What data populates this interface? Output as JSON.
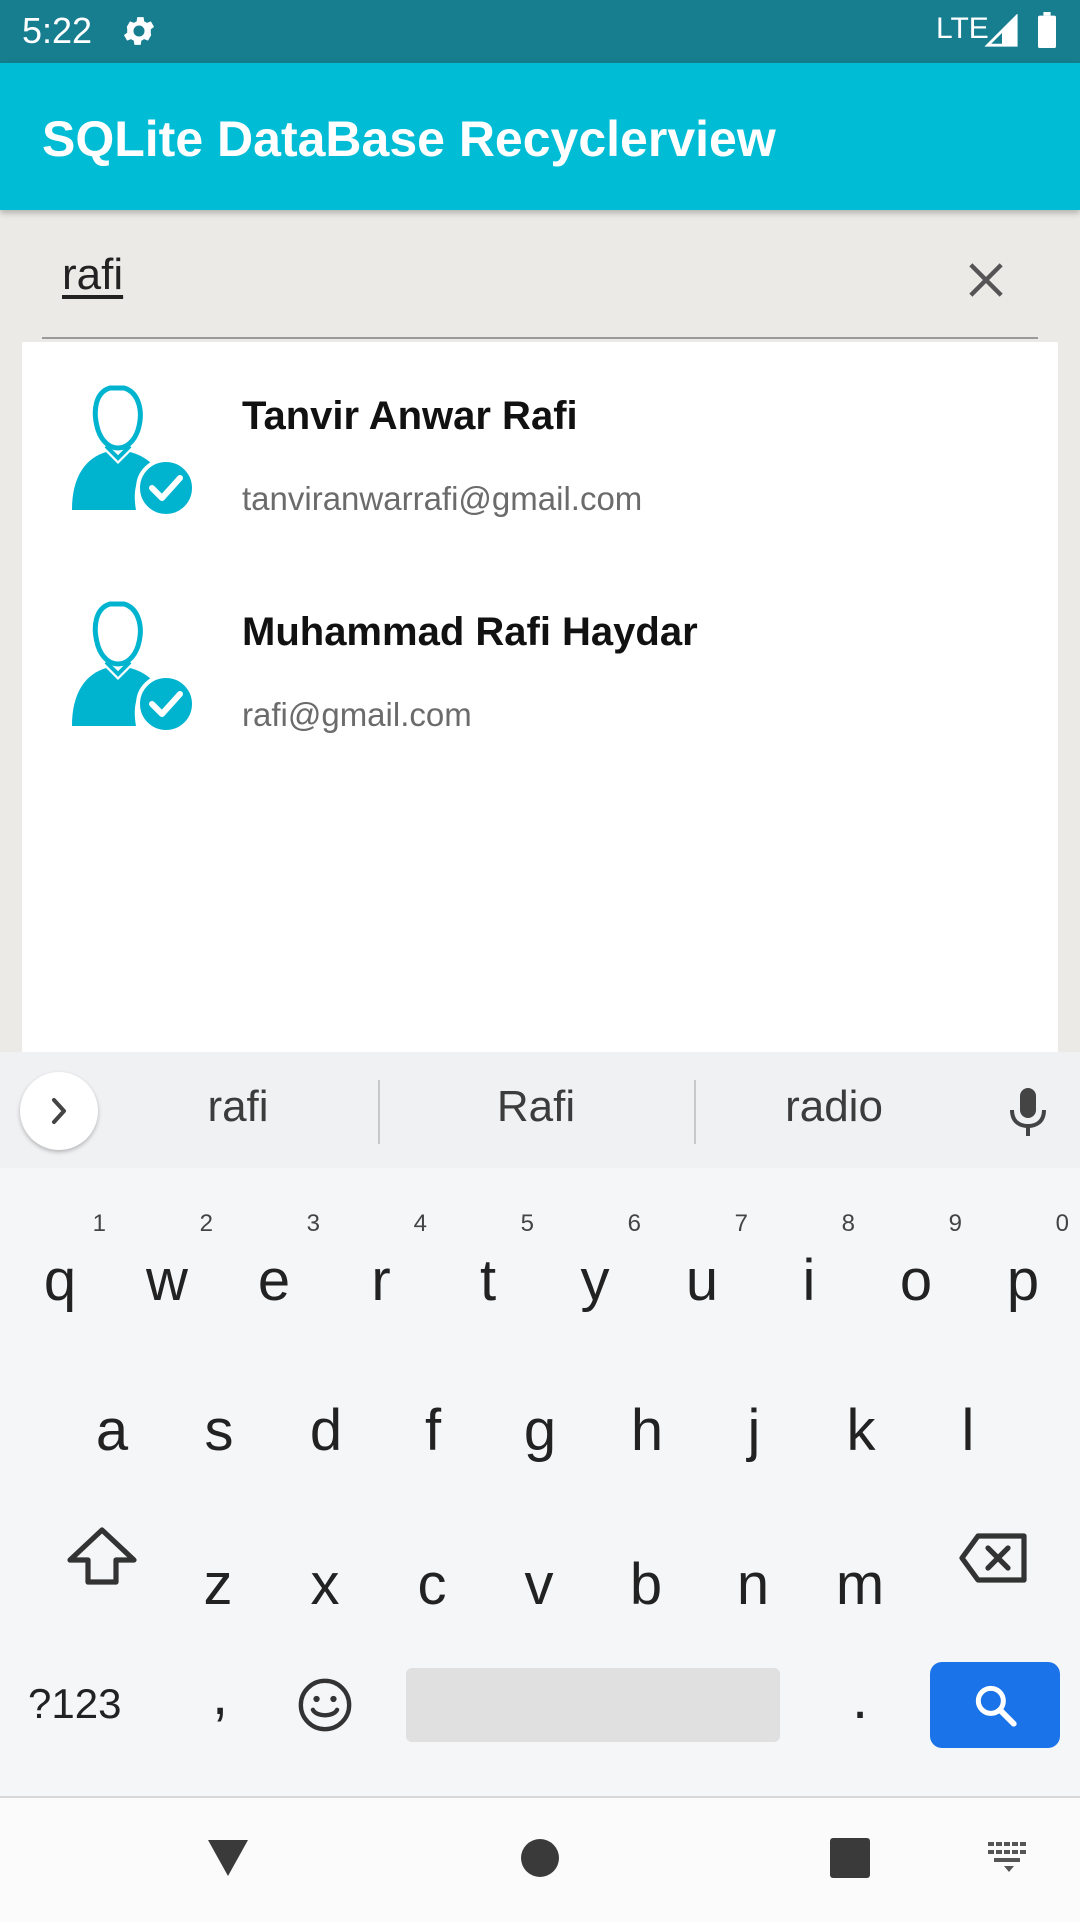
{
  "status_bar": {
    "time": "5:22",
    "network": "LTE",
    "icons": [
      "gear-icon",
      "signal-icon",
      "battery-icon"
    ]
  },
  "app_bar": {
    "title": "SQLite DataBase Recyclerview",
    "color": "#00bcd4"
  },
  "search": {
    "value": "rafi",
    "clear_icon": "close-icon"
  },
  "contacts": [
    {
      "name": "Tanvir Anwar Rafi",
      "email": "tanviranwarrafi@gmail.com",
      "icon": "verified-user-icon"
    },
    {
      "name": "Muhammad Rafi Haydar",
      "email": "rafi@gmail.com",
      "icon": "verified-user-icon"
    }
  ],
  "keyboard": {
    "suggestions": [
      "rafi",
      "Rafi",
      "radio"
    ],
    "row1": [
      "q",
      "w",
      "e",
      "r",
      "t",
      "y",
      "u",
      "i",
      "o",
      "p"
    ],
    "row1_hints": [
      "1",
      "2",
      "3",
      "4",
      "5",
      "6",
      "7",
      "8",
      "9",
      "0"
    ],
    "row2": [
      "a",
      "s",
      "d",
      "f",
      "g",
      "h",
      "j",
      "k",
      "l"
    ],
    "row3": [
      "z",
      "x",
      "c",
      "v",
      "b",
      "n",
      "m"
    ],
    "symbols_label": "?123",
    "comma": ",",
    "period": ".",
    "accent": "#1a73e8"
  },
  "nav_bar": {
    "icons": [
      "back-icon",
      "home-icon",
      "recents-icon",
      "keyboard-switch-icon"
    ]
  }
}
